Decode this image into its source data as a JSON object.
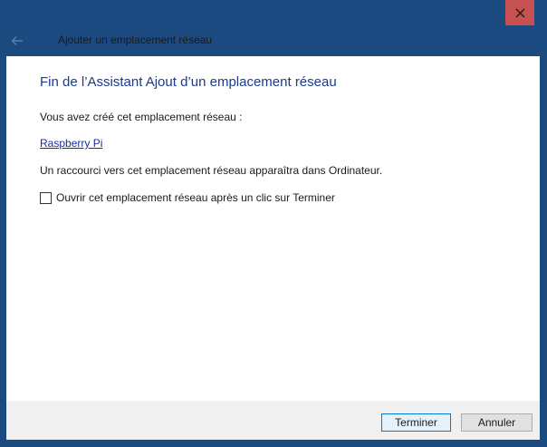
{
  "window": {
    "title": "Ajouter un emplacement réseau"
  },
  "content": {
    "heading": "Fin de l’Assistant Ajout d’un emplacement réseau",
    "created_text": "Vous avez créé cet emplacement réseau :",
    "location_link": "Raspberry Pi",
    "shortcut_text": "Un raccourci vers cet emplacement réseau apparaîtra dans Ordinateur.",
    "open_checkbox": {
      "label": "Ouvrir cet emplacement réseau après un clic sur Terminer",
      "checked": false
    }
  },
  "footer": {
    "finish_label": "Terminer",
    "cancel_label": "Annuler"
  },
  "colors": {
    "chrome": "#1b4a80",
    "close": "#c75050",
    "heading": "#1a3a8a",
    "link": "#1a2d9a",
    "primary_border": "#0078d7"
  },
  "icons": {
    "close": "close-icon",
    "back": "back-arrow-icon",
    "checkbox": "checkbox-unchecked-icon"
  }
}
